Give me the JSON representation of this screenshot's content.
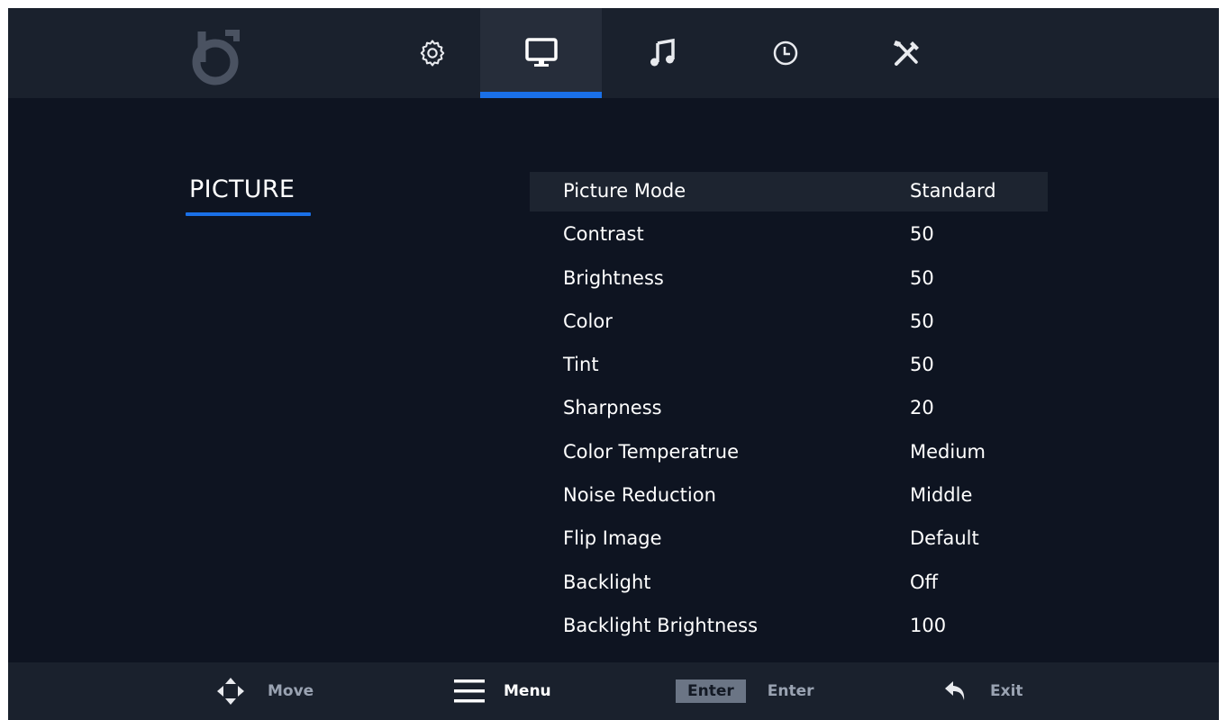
{
  "nav": {
    "tabs": [
      {
        "name": "settings",
        "icon": "gear-icon",
        "active": false
      },
      {
        "name": "picture",
        "icon": "monitor-icon",
        "active": true
      },
      {
        "name": "sound",
        "icon": "music-note-icon",
        "active": false
      },
      {
        "name": "time",
        "icon": "clock-icon",
        "active": false
      },
      {
        "name": "tools",
        "icon": "tools-icon",
        "active": false
      }
    ]
  },
  "section": {
    "title": "PICTURE"
  },
  "menu": {
    "items": [
      {
        "label": "Picture Mode",
        "value": "Standard"
      },
      {
        "label": "Contrast",
        "value": "50"
      },
      {
        "label": "Brightness",
        "value": "50"
      },
      {
        "label": "Color",
        "value": "50"
      },
      {
        "label": "Tint",
        "value": "50"
      },
      {
        "label": "Sharpness",
        "value": "20"
      },
      {
        "label": "Color Temperatrue",
        "value": "Medium"
      },
      {
        "label": "Noise Reduction",
        "value": "Middle"
      },
      {
        "label": "Flip Image",
        "value": "Default"
      },
      {
        "label": "Backlight",
        "value": "Off"
      },
      {
        "label": "Backlight Brightness",
        "value": "100"
      }
    ]
  },
  "footer": {
    "move": {
      "icon": "directional-pad-icon",
      "label": "Move"
    },
    "menu": {
      "icon": "hamburger-menu-icon",
      "label": "Menu"
    },
    "enter": {
      "key": "Enter",
      "label": "Enter"
    },
    "exit": {
      "icon": "return-arrow-icon",
      "label": "Exit"
    }
  },
  "colors": {
    "accent": "#1a70e8",
    "background": "#0e1421",
    "bar": "#1a212d"
  }
}
